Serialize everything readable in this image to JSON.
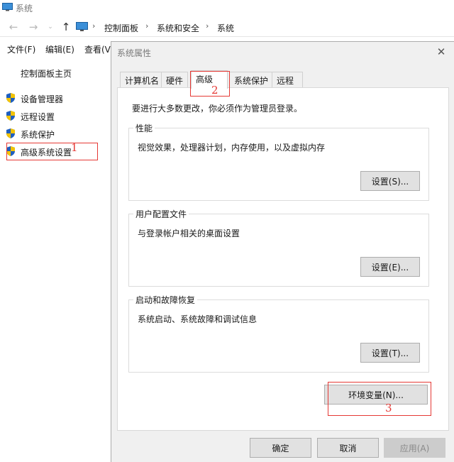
{
  "window": {
    "title": "系统"
  },
  "nav": {
    "breadcrumb": [
      "控制面板",
      "系统和安全",
      "系统"
    ]
  },
  "menu": [
    "文件(F)",
    "编辑(E)",
    "查看(V)"
  ],
  "sidebar": {
    "home": "控制面板主页",
    "links": [
      "设备管理器",
      "远程设置",
      "系统保护",
      "高级系统设置"
    ]
  },
  "dialog": {
    "title": "系统属性",
    "tabs": [
      "计算机名",
      "硬件",
      "高级",
      "系统保护",
      "远程"
    ],
    "active_tab": "高级",
    "admin_note": "要进行大多数更改，你必须作为管理员登录。",
    "groups": [
      {
        "label": "性能",
        "desc": "视觉效果，处理器计划，内存使用，以及虚拟内存",
        "button": "设置(S)..."
      },
      {
        "label": "用户配置文件",
        "desc": "与登录帐户相关的桌面设置",
        "button": "设置(E)..."
      },
      {
        "label": "启动和故障恢复",
        "desc": "系统启动、系统故障和调试信息",
        "button": "设置(T)..."
      }
    ],
    "env_button": "环境变量(N)...",
    "footer": {
      "ok": "确定",
      "cancel": "取消",
      "apply": "应用(A)"
    }
  },
  "annotations": [
    "1",
    "2",
    "3"
  ],
  "colors": {
    "annotation": "#e53935",
    "shield_blue": "#1f5fbf",
    "shield_yellow": "#f2c200"
  },
  "icons": {
    "shield": "uac-shield-icon",
    "monitor": "computer-monitor-icon"
  }
}
